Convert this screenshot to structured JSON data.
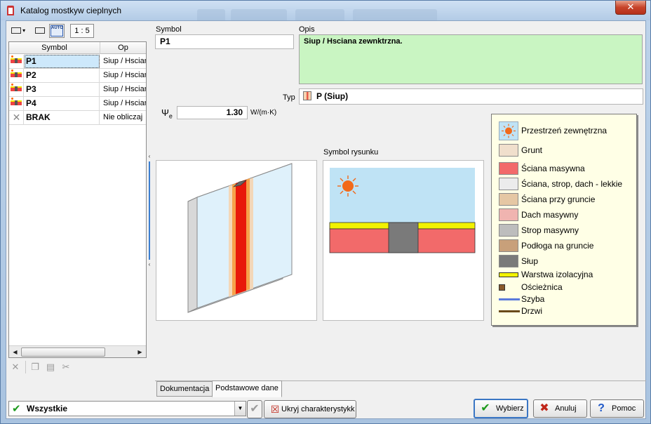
{
  "window": {
    "title": "Katalog mostkyw cieplnych",
    "close_label": "✕"
  },
  "left_toolbar": {
    "zoom_label": "1 : 5",
    "auto_label": "AUTO"
  },
  "grid": {
    "columns": [
      "Symbol",
      "Op"
    ],
    "rows": [
      {
        "symbol": "P1",
        "desc": "Siup / Hsciana",
        "icon": "pillar-icon"
      },
      {
        "symbol": "P2",
        "desc": "Siup / Hsciana",
        "icon": "pillar-icon"
      },
      {
        "symbol": "P3",
        "desc": "Siup / Hsciana",
        "icon": "pillar-icon"
      },
      {
        "symbol": "P4",
        "desc": "Siup / Hsciana",
        "icon": "pillar-icon"
      },
      {
        "symbol": "BRAK",
        "desc": "Nie obliczaj",
        "icon": "none-icon"
      }
    ],
    "selected_index": 0
  },
  "form": {
    "symbol_label": "Symbol",
    "symbol_value": "P1",
    "opis_label": "Opis",
    "opis_value": "Siup / Hsciana zewnktrzna.",
    "typ_label": "Typ",
    "typ_value": "P (Siup)",
    "psi_label": "Ψ",
    "psi_sub": "e",
    "psi_value": "1.30",
    "psi_unit": "W/(m·K)",
    "symbol_rysunku_label": "Symbol rysunku"
  },
  "legend": [
    {
      "label": "Przestrzeń zewnętrzna",
      "swatch": "sun",
      "color": "#bfe3f5"
    },
    {
      "label": "Grunt",
      "swatch": "box",
      "color": "#f0dfcc"
    },
    {
      "label": "Ściana masywna",
      "swatch": "box",
      "color": "#f26a6a"
    },
    {
      "label": "Ściana, strop, dach - lekkie",
      "swatch": "box",
      "color": "#ececec"
    },
    {
      "label": "Ściana przy gruncie",
      "swatch": "box",
      "color": "#e5c7a4"
    },
    {
      "label": "Dach masywny",
      "swatch": "box",
      "color": "#f0b4b0"
    },
    {
      "label": "Strop masywny",
      "swatch": "box",
      "color": "#bdbdbd"
    },
    {
      "label": "Podłoga na gruncie",
      "swatch": "box",
      "color": "#c8a07a"
    },
    {
      "label": "Słup",
      "swatch": "box",
      "color": "#7a7a7a"
    },
    {
      "label": "Warstwa izolacyjna",
      "swatch": "bar",
      "color": "#f2f200"
    },
    {
      "label": "Ościeżnica",
      "swatch": "small",
      "color": "#8a5a2a"
    },
    {
      "label": "Szyba",
      "swatch": "line",
      "color": "#5a7adb"
    },
    {
      "label": "Drzwi",
      "swatch": "line",
      "color": "#6a4a1a"
    }
  ],
  "tabs": [
    {
      "label": "Dokumentacja",
      "active": false
    },
    {
      "label": "Podstawowe dane",
      "active": true
    }
  ],
  "footer": {
    "filter_value": "Wszystkie",
    "hide_btn": "Ukryj charakterystykk",
    "select_btn": "Wybierz",
    "cancel_btn": "Anuluj",
    "help_btn": "Pomoc"
  },
  "colors": {
    "accent": "#3a76c4",
    "opis_bg": "#c9f5c2",
    "ok_green": "#1c9a1c",
    "cancel_red": "#c0261a",
    "help_blue": "#1f58c8"
  }
}
